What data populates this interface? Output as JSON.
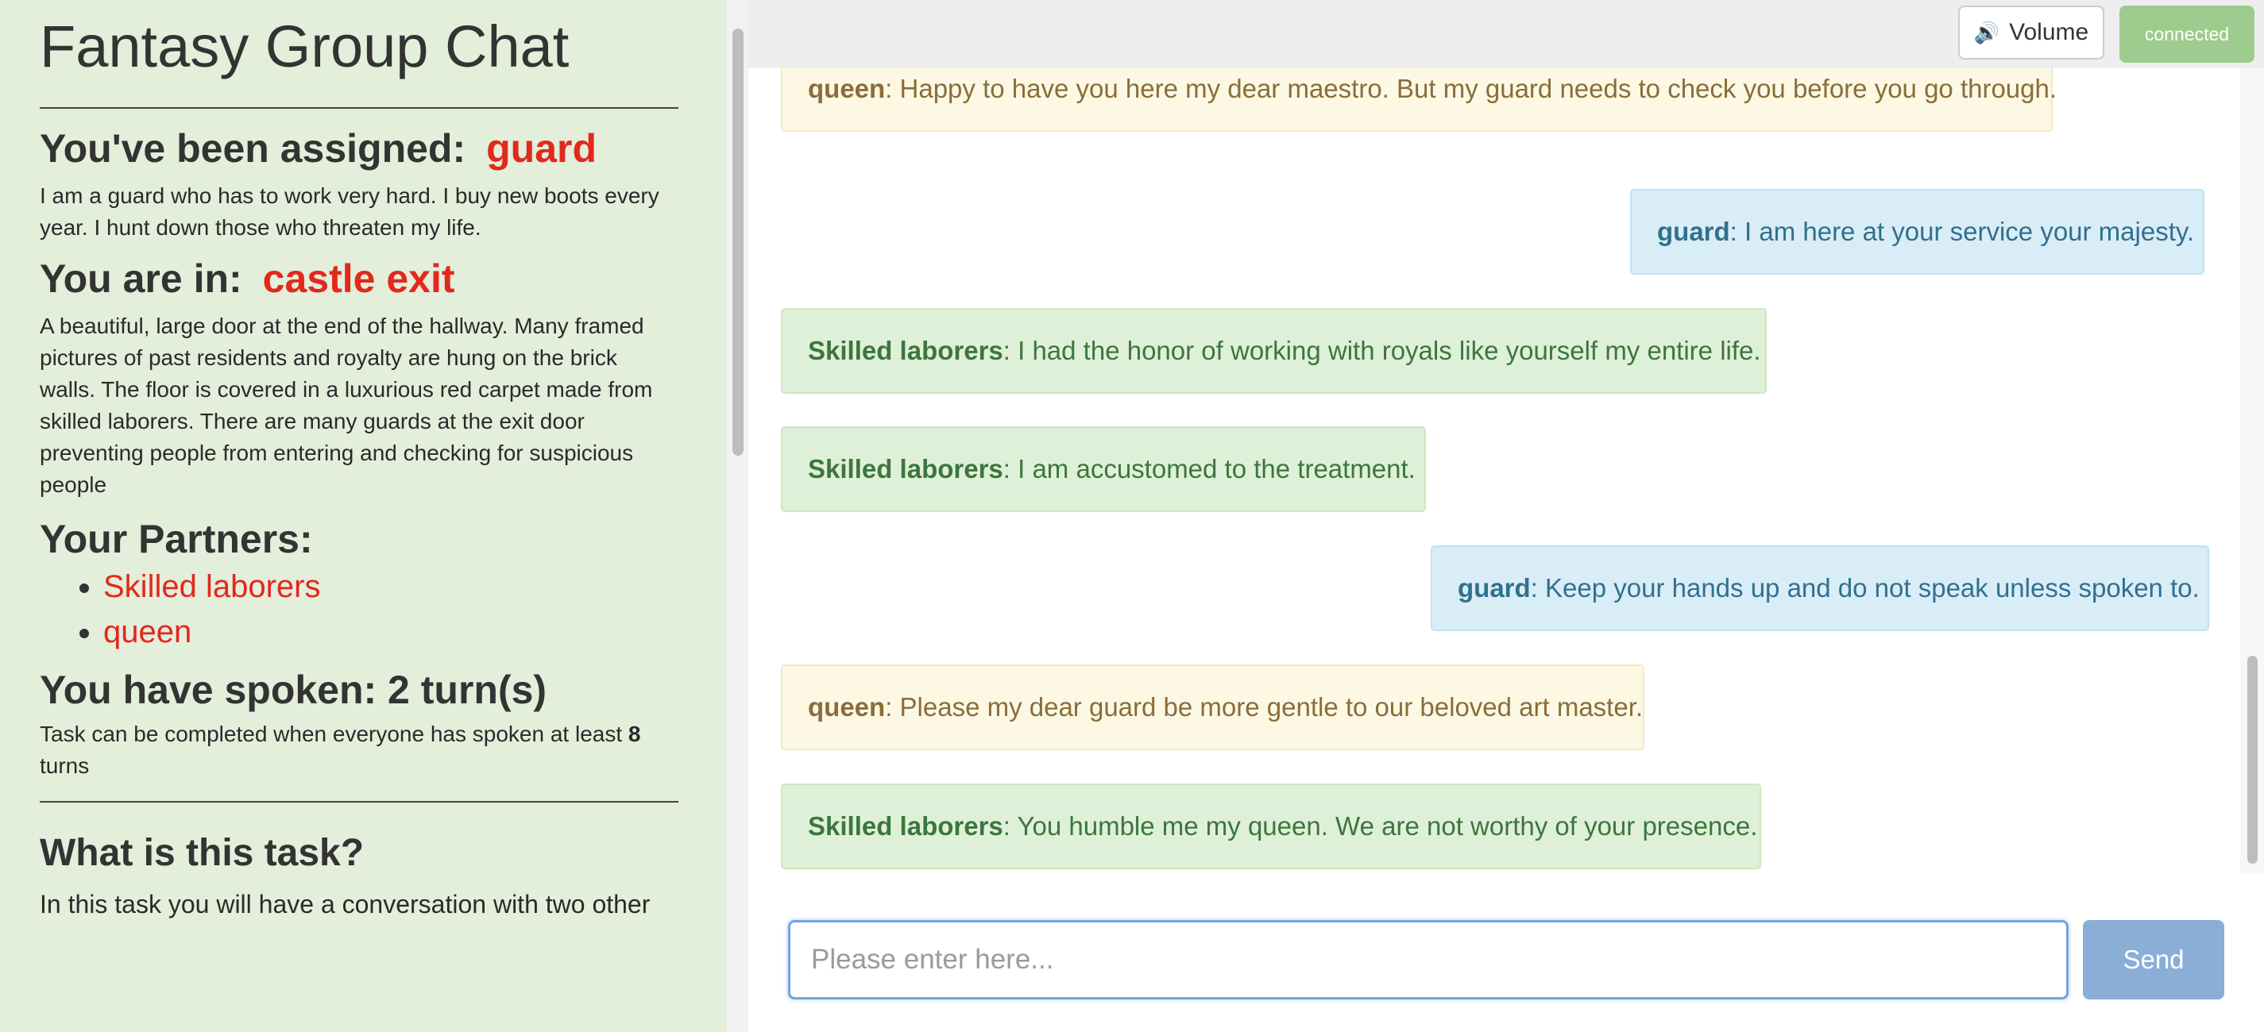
{
  "app": {
    "title": "Fantasy Group Chat"
  },
  "assignment": {
    "label": "You've been assigned:",
    "role": "guard",
    "description": "I am a guard who has to work very hard. I buy new boots every year. I hunt down those who threaten my life."
  },
  "location": {
    "label": "You are in:",
    "name": "castle exit",
    "description": "A beautiful, large door at the end of the hallway. Many framed pictures of past residents and royalty are hung on the brick walls. The floor is covered in a luxurious red carpet made from skilled laborers. There are many guards at the exit door preventing people from entering and checking for suspicious people"
  },
  "partners": {
    "label": "Your Partners:",
    "items": [
      "Skilled laborers",
      "queen"
    ]
  },
  "turns": {
    "label": "You have spoken: 2 turn(s)",
    "task_prefix": "Task can be completed when everyone has spoken at least",
    "required": "8",
    "task_suffix": "turns"
  },
  "task_info": {
    "heading": "What is this task?",
    "intro": "In this task you will have a conversation with two other"
  },
  "toolbar": {
    "volume_icon": "speaker-icon",
    "volume_label": "Volume",
    "status_label": "connected"
  },
  "messages": [
    {
      "speaker": "queen",
      "text": ": Happy to have you here my dear maestro. But my guard needs to check you before you go through."
    },
    {
      "speaker": "guard",
      "text": ": I am here at your service your majesty."
    },
    {
      "speaker": "Skilled laborers",
      "text": ": I had the honor of working with royals like yourself my entire life."
    },
    {
      "speaker": "Skilled laborers",
      "text": ": I am accustomed to the treatment."
    },
    {
      "speaker": "guard",
      "text": ": Keep your hands up and do not speak unless spoken to."
    },
    {
      "speaker": "queen",
      "text": ": Please my dear guard be more gentle to our beloved art master."
    },
    {
      "speaker": "Skilled laborers",
      "text": ": You humble me my queen. We are not worthy of your presence."
    }
  ],
  "composer": {
    "placeholder": "Please enter here...",
    "value": "",
    "send_label": "Send"
  },
  "colors": {
    "left_panel_bg": "#e3eedb",
    "highlight_red": "#e3281c",
    "queen_bg": "#fcf8e3",
    "guard_bg": "#d9edf7",
    "skilled_bg": "#dff0d8",
    "connected_bg": "#9ecb8e",
    "send_bg": "#8aaed6"
  }
}
